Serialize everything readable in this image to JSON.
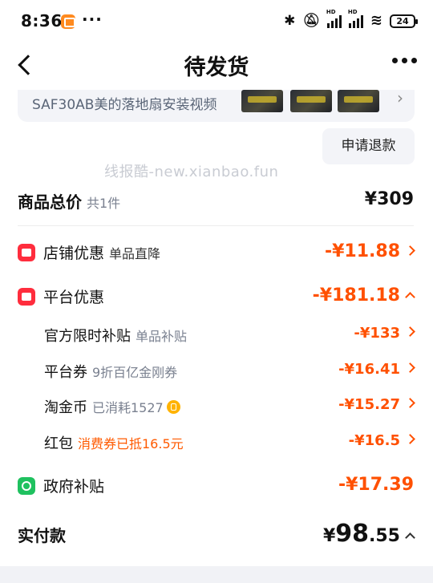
{
  "status_bar": {
    "time": "8:36",
    "dots": "···",
    "hd1": "HD",
    "hd2": "HD",
    "battery": "24"
  },
  "header": {
    "title": "待发货"
  },
  "product": {
    "video_title": "SAF30AB美的落地扇安装视频"
  },
  "refund": {
    "label": "申请退款"
  },
  "watermark": "线报酷-new.xianbao.fun",
  "summary": {
    "label": "商品总价",
    "count": "共1件",
    "amount": "¥309"
  },
  "discounts": {
    "store": {
      "label": "店铺优惠",
      "sub": "单品直降",
      "amount": "-¥11.88"
    },
    "platform": {
      "label": "平台优惠",
      "amount": "-¥181.18"
    },
    "items": [
      {
        "label": "官方限时补贴",
        "sub": "单品补贴",
        "amount": "-¥133"
      },
      {
        "label": "平台券",
        "sub": "9折百亿金刚券",
        "amount": "-¥16.41"
      },
      {
        "label": "淘金币",
        "sub": "已消耗1527",
        "amount": "-¥15.27"
      },
      {
        "label": "红包",
        "sub": "消费券已抵16.5元",
        "amount": "-¥16.5"
      }
    ],
    "government": {
      "label": "政府补贴",
      "amount": "-¥17.39"
    }
  },
  "total": {
    "label": "实付款",
    "currency": "¥",
    "integer": "98",
    "decimal": ".55"
  },
  "colors": {
    "accent": "#ff5000",
    "store_icon": "#ff2d3d",
    "gov_icon": "#1fc15f",
    "coin": "#ffb300"
  }
}
